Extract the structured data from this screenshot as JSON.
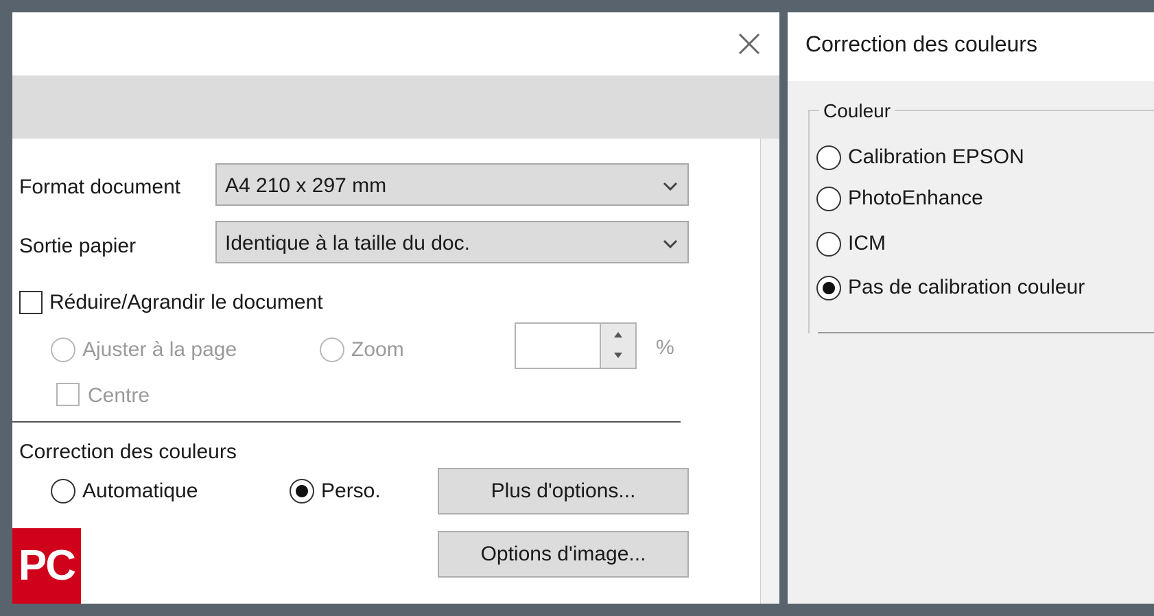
{
  "print_dialog": {
    "format_label": "Format document",
    "format_value": "A4 210 x 297 mm",
    "sortie_label": "Sortie papier",
    "sortie_value": "Identique à la taille du doc.",
    "reduce_label": "Réduire/Agrandir le document",
    "reduce_checked": false,
    "fit_page_label": "Ajuster à la page",
    "zoom_label": "Zoom",
    "zoom_value": "",
    "percent_sign": "%",
    "center_label": "Centre",
    "color_correction_label": "Correction des couleurs",
    "auto_label": "Automatique",
    "perso_label": "Perso.",
    "perso_selected": true,
    "more_options_button": "Plus d'options...",
    "image_options_button": "Options d'image..."
  },
  "color_panel": {
    "title": "Correction des couleurs",
    "group_label": "Couleur",
    "options": [
      {
        "label": "Calibration EPSON",
        "selected": false
      },
      {
        "label": "PhotoEnhance",
        "selected": false
      },
      {
        "label": "ICM",
        "selected": false
      },
      {
        "label": "Pas de calibration couleur",
        "selected": true
      }
    ]
  },
  "watermark": {
    "text": "PC",
    "color": "#d0021b"
  },
  "colors": {
    "background": "#59636d",
    "dialog": "#f2f2f2",
    "combo": "#dcdcdc"
  },
  "icons": {
    "close": "close-icon",
    "dropdown": "chevron-down-icon",
    "spin_up": "spin-up-icon",
    "spin_down": "spin-down-icon"
  }
}
